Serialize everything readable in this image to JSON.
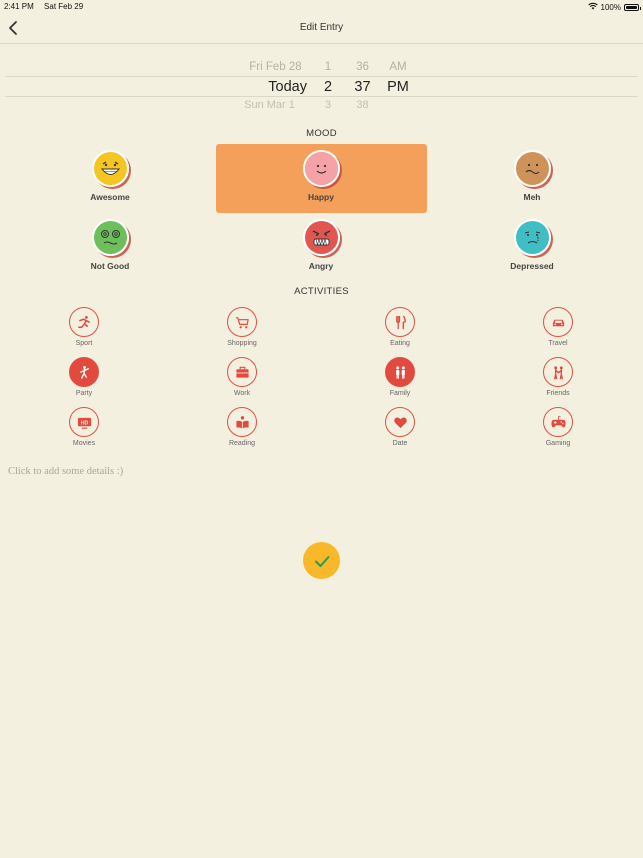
{
  "status": {
    "time": "2:41 PM",
    "date": "Sat Feb 29",
    "battery": "100%",
    "battery_fraction": 1.0
  },
  "nav": {
    "title": "Edit Entry"
  },
  "picker": {
    "above": {
      "date": "Fri Feb 28",
      "hour": "1",
      "minute": "36",
      "ampm": "AM"
    },
    "selected": {
      "date": "Today",
      "hour": "2",
      "minute": "37",
      "ampm": "PM"
    },
    "below": {
      "date": "Sun Mar 1",
      "hour": "3",
      "minute": "38"
    }
  },
  "mood": {
    "heading": "MOOD",
    "selected": "Happy",
    "items": [
      {
        "label": "Awesome",
        "icon": "awesome-face-icon",
        "color": "#f5c523"
      },
      {
        "label": "Happy",
        "icon": "happy-face-icon",
        "color": "#f4a2a6"
      },
      {
        "label": "Meh",
        "icon": "meh-face-icon",
        "color": "#cf935a"
      },
      {
        "label": "Not Good",
        "icon": "not-good-face-icon",
        "color": "#6cbf5a"
      },
      {
        "label": "Angry",
        "icon": "angry-face-icon",
        "color": "#e05650"
      },
      {
        "label": "Depressed",
        "icon": "depressed-face-icon",
        "color": "#3fbfc4"
      }
    ]
  },
  "activities": {
    "heading": "ACTIVITIES",
    "accent": "#e34a3f",
    "items": [
      {
        "label": "Sport",
        "icon": "runner-icon",
        "selected": false
      },
      {
        "label": "Shopping",
        "icon": "shopping-cart-icon",
        "selected": false
      },
      {
        "label": "Eating",
        "icon": "fork-knife-icon",
        "selected": false
      },
      {
        "label": "Travel",
        "icon": "car-icon",
        "selected": false
      },
      {
        "label": "Party",
        "icon": "dancer-icon",
        "selected": true
      },
      {
        "label": "Work",
        "icon": "briefcase-icon",
        "selected": false
      },
      {
        "label": "Family",
        "icon": "family-icon",
        "selected": true
      },
      {
        "label": "Friends",
        "icon": "friends-icon",
        "selected": false
      },
      {
        "label": "Movies",
        "icon": "hd-tv-icon",
        "selected": false
      },
      {
        "label": "Reading",
        "icon": "reading-icon",
        "selected": false
      },
      {
        "label": "Date",
        "icon": "heart-icon",
        "selected": false
      },
      {
        "label": "Gaming",
        "icon": "gamepad-icon",
        "selected": false
      }
    ]
  },
  "details": {
    "placeholder": "Click to add some details :)"
  },
  "save": {
    "icon": "checkmark-icon",
    "color": "#f9b82a"
  }
}
